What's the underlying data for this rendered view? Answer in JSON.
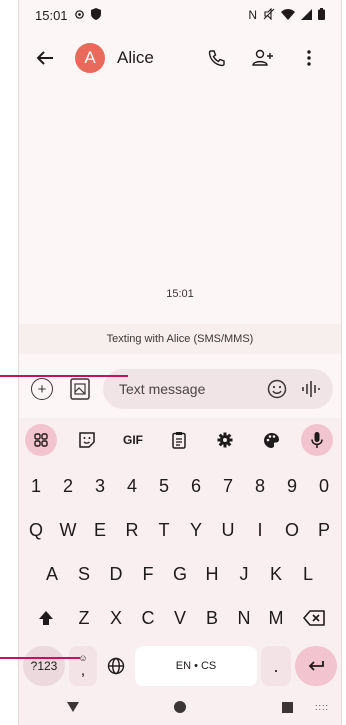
{
  "status_bar": {
    "time": "15:01",
    "left_icons": [
      "gear-icon",
      "shield-icon"
    ],
    "right_icons": [
      "nfc-icon",
      "mute-icon",
      "wifi-icon",
      "signal-icon",
      "battery-icon"
    ]
  },
  "app_bar": {
    "avatar_letter": "A",
    "contact_name": "Alice",
    "avatar_color": "#e96a5a"
  },
  "conversation": {
    "timestamp": "15:01",
    "banner": "Texting with Alice (SMS/MMS)"
  },
  "composer": {
    "placeholder": "Text message"
  },
  "keyboard": {
    "toolbar": [
      "apps",
      "sticker",
      "GIF",
      "clipboard",
      "settings",
      "theme",
      "mic"
    ],
    "gif_label": "GIF",
    "row_numbers": [
      "1",
      "2",
      "3",
      "4",
      "5",
      "6",
      "7",
      "8",
      "9",
      "0"
    ],
    "row_q": [
      "Q",
      "W",
      "E",
      "R",
      "T",
      "Y",
      "U",
      "I",
      "O",
      "P"
    ],
    "row_a": [
      "A",
      "S",
      "D",
      "F",
      "G",
      "H",
      "J",
      "K",
      "L"
    ],
    "row_z": [
      "Z",
      "X",
      "C",
      "V",
      "B",
      "N",
      "M"
    ],
    "key_123": "?123",
    "emoji_comma": ",",
    "space_label": "EN • CS",
    "period": "."
  },
  "colors": {
    "accent_pink": "#f2c4cf",
    "callout": "#c0155b",
    "background": "#fdf6f7"
  }
}
